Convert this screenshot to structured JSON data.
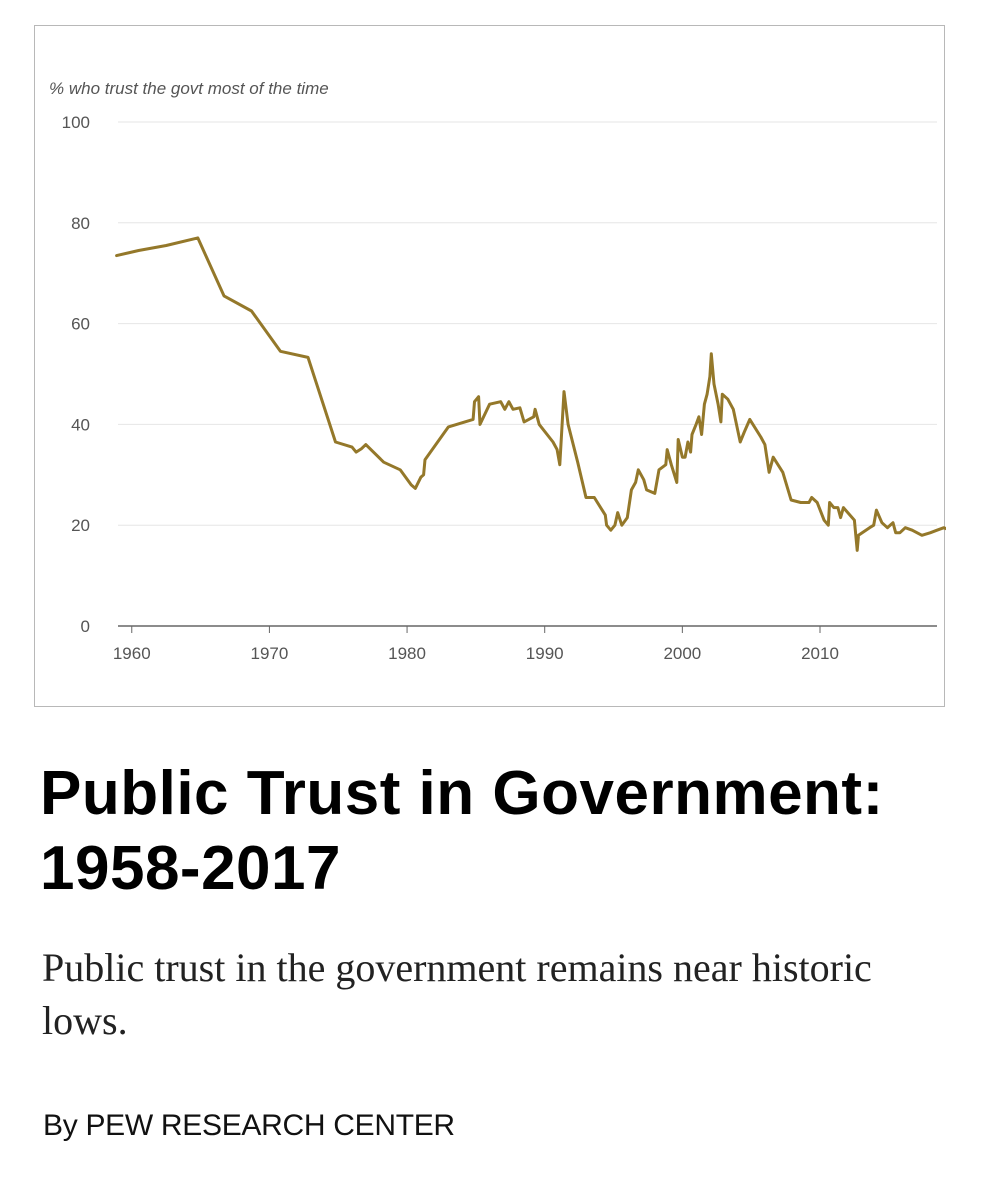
{
  "title": "Public Trust in Government: 1958-2017",
  "subtitle": "Public trust in the government remains near historic lows.",
  "byline": "By PEW RESEARCH CENTER",
  "colors": {
    "line": "#94782a",
    "grid": "#e6e6e6",
    "axis": "#666666"
  },
  "chart_data": {
    "type": "line",
    "title": "",
    "xlabel": "",
    "ylabel": "% who trust the govt most of the time",
    "xlim": [
      1959,
      2018.5
    ],
    "ylim": [
      0,
      100
    ],
    "x_ticks": [
      1960,
      1970,
      1980,
      1990,
      2000,
      2010
    ],
    "y_ticks": [
      0,
      20,
      40,
      60,
      80,
      100
    ],
    "grid": true,
    "legend": "none",
    "series": [
      {
        "values": [
          [
            1958.9,
            73.5
          ],
          [
            1960.5,
            74.5
          ],
          [
            1962.5,
            75.5
          ],
          [
            1964.8,
            77.0
          ],
          [
            1966.7,
            65.5
          ],
          [
            1968.7,
            62.5
          ],
          [
            1970.8,
            54.5
          ],
          [
            1972.8,
            53.3
          ],
          [
            1974.8,
            36.5
          ],
          [
            1976.0,
            35.5
          ],
          [
            1976.3,
            34.5
          ],
          [
            1976.7,
            35.2
          ],
          [
            1977.0,
            36.0
          ],
          [
            1978.3,
            32.5
          ],
          [
            1979.5,
            31.0
          ],
          [
            1980.3,
            28.0
          ],
          [
            1980.6,
            27.3
          ],
          [
            1981.0,
            29.5
          ],
          [
            1981.2,
            30.0
          ],
          [
            1981.3,
            33.0
          ],
          [
            1983.0,
            39.5
          ],
          [
            1984.8,
            41.0
          ],
          [
            1984.9,
            44.5
          ],
          [
            1985.2,
            45.5
          ],
          [
            1985.3,
            40.0
          ],
          [
            1986.0,
            44.0
          ],
          [
            1986.8,
            44.5
          ],
          [
            1987.1,
            43.0
          ],
          [
            1987.4,
            44.5
          ],
          [
            1987.7,
            43.0
          ],
          [
            1988.2,
            43.3
          ],
          [
            1988.5,
            40.5
          ],
          [
            1989.2,
            41.5
          ],
          [
            1989.3,
            43.0
          ],
          [
            1989.6,
            40.0
          ],
          [
            1990.6,
            36.5
          ],
          [
            1990.9,
            35.0
          ],
          [
            1991.1,
            32.0
          ],
          [
            1991.4,
            46.5
          ],
          [
            1991.7,
            40.0
          ],
          [
            1992.4,
            32.5
          ],
          [
            1993.0,
            25.5
          ],
          [
            1993.6,
            25.5
          ],
          [
            1994.4,
            22.0
          ],
          [
            1994.5,
            20.0
          ],
          [
            1994.8,
            19.0
          ],
          [
            1995.1,
            20.0
          ],
          [
            1995.3,
            22.5
          ],
          [
            1995.6,
            20.0
          ],
          [
            1996.0,
            21.5
          ],
          [
            1996.3,
            27.0
          ],
          [
            1996.6,
            28.5
          ],
          [
            1996.8,
            31.0
          ],
          [
            1997.2,
            29.0
          ],
          [
            1997.4,
            27.0
          ],
          [
            1998.0,
            26.3
          ],
          [
            1998.3,
            31.0
          ],
          [
            1998.8,
            32.0
          ],
          [
            1998.9,
            35.0
          ],
          [
            1999.2,
            32.0
          ],
          [
            1999.6,
            28.5
          ],
          [
            1999.7,
            37.0
          ],
          [
            2000.0,
            33.5
          ],
          [
            2000.2,
            33.5
          ],
          [
            2000.4,
            36.5
          ],
          [
            2000.6,
            34.5
          ],
          [
            2000.7,
            38.0
          ],
          [
            2001.0,
            40.0
          ],
          [
            2001.2,
            41.5
          ],
          [
            2001.4,
            38.0
          ],
          [
            2001.6,
            44.0
          ],
          [
            2001.8,
            46.0
          ],
          [
            2002.0,
            49.5
          ],
          [
            2002.1,
            54.0
          ],
          [
            2002.3,
            48.0
          ],
          [
            2002.6,
            44.0
          ],
          [
            2002.8,
            40.5
          ],
          [
            2002.9,
            46.0
          ],
          [
            2003.3,
            45.0
          ],
          [
            2003.7,
            43.0
          ],
          [
            2004.2,
            36.5
          ],
          [
            2004.5,
            38.5
          ],
          [
            2004.9,
            41.0
          ],
          [
            2005.7,
            37.5
          ],
          [
            2006.0,
            36.0
          ],
          [
            2006.3,
            30.5
          ],
          [
            2006.6,
            33.5
          ],
          [
            2007.3,
            30.5
          ],
          [
            2007.9,
            25.0
          ],
          [
            2008.6,
            24.5
          ],
          [
            2009.2,
            24.5
          ],
          [
            2009.4,
            25.5
          ],
          [
            2009.8,
            24.5
          ],
          [
            2010.3,
            21.0
          ],
          [
            2010.6,
            20.0
          ],
          [
            2010.7,
            24.5
          ],
          [
            2011.0,
            23.5
          ],
          [
            2011.3,
            23.5
          ],
          [
            2011.5,
            21.5
          ],
          [
            2011.7,
            23.5
          ],
          [
            2012.5,
            21.0
          ],
          [
            2012.7,
            15.0
          ],
          [
            2012.8,
            18.0
          ],
          [
            2013.6,
            19.5
          ],
          [
            2013.9,
            20.0
          ],
          [
            2014.1,
            23.0
          ],
          [
            2014.5,
            20.5
          ],
          [
            2014.9,
            19.5
          ],
          [
            2015.3,
            20.5
          ],
          [
            2015.5,
            18.5
          ],
          [
            2015.8,
            18.5
          ],
          [
            2016.2,
            19.5
          ],
          [
            2016.7,
            19.0
          ],
          [
            2017.4,
            18.0
          ],
          [
            2018.0,
            18.5
          ],
          [
            2018.5,
            19.0
          ],
          [
            2019.0,
            19.5
          ],
          [
            2019.4,
            19.0
          ],
          [
            2019.7,
            18.5
          ]
        ]
      }
    ]
  }
}
